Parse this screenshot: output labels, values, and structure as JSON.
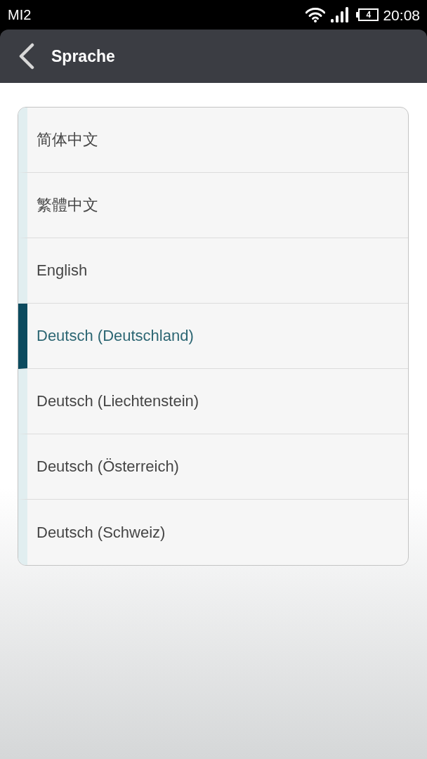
{
  "status_bar": {
    "carrier": "MI2",
    "battery_text": "4",
    "time": "20:08"
  },
  "title_bar": {
    "title": "Sprache"
  },
  "items": [
    {
      "label": "简体中文",
      "selected": false
    },
    {
      "label": "繁體中文",
      "selected": false
    },
    {
      "label": "English",
      "selected": false
    },
    {
      "label": "Deutsch (Deutschland)",
      "selected": true
    },
    {
      "label": "Deutsch (Liechtenstein)",
      "selected": false
    },
    {
      "label": "Deutsch (Österreich)",
      "selected": false
    },
    {
      "label": "Deutsch (Schweiz)",
      "selected": false
    }
  ]
}
